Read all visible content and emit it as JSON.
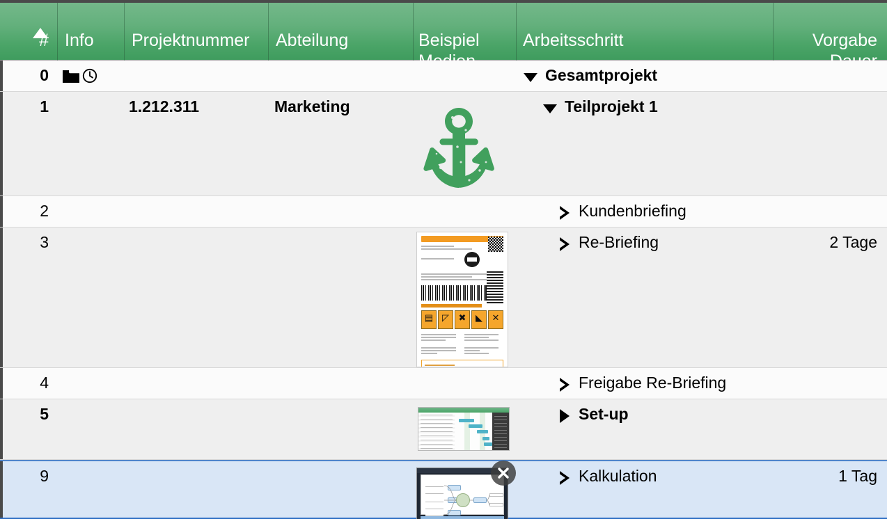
{
  "table": {
    "columns": [
      {
        "id": "num",
        "label": "#",
        "align": "right",
        "sorted": true,
        "sort_direction": "ascending"
      },
      {
        "id": "info",
        "label": "Info",
        "align": "left"
      },
      {
        "id": "proj",
        "label": "Projektnummer",
        "align": "left"
      },
      {
        "id": "abt",
        "label": "Abteilung",
        "align": "left"
      },
      {
        "id": "media",
        "label": "Beispiel\nMedien",
        "align": "left"
      },
      {
        "id": "step",
        "label": "Arbeitsschritt",
        "align": "left"
      },
      {
        "id": "dur",
        "label": "Vorgabe\nDauer",
        "align": "right"
      }
    ],
    "rows": [
      {
        "num": "0",
        "projektnummer": "",
        "abteilung": "",
        "arbeitsschritt": "Gesamtprojekt",
        "dauer": "",
        "level": 0,
        "bold": true,
        "disclosure": "expanded",
        "icons": [
          "folder-icon",
          "clock-icon"
        ],
        "media": "none",
        "stripe": "odd",
        "selected": false
      },
      {
        "num": "1",
        "projektnummer": "1.212.311",
        "abteilung": "Marketing",
        "arbeitsschritt": "Teilprojekt 1",
        "dauer": "",
        "level": 1,
        "bold": true,
        "disclosure": "expanded",
        "icons": [],
        "media": "anchor-logo",
        "stripe": "even",
        "selected": false
      },
      {
        "num": "2",
        "projektnummer": "",
        "abteilung": "",
        "arbeitsschritt": "Kundenbriefing",
        "dauer": "",
        "level": 2,
        "bold": false,
        "disclosure": "leaf",
        "icons": [],
        "media": "none",
        "stripe": "odd",
        "selected": false
      },
      {
        "num": "3",
        "projektnummer": "",
        "abteilung": "",
        "arbeitsschritt": "Re-Briefing",
        "dauer": "2 Tage",
        "level": 2,
        "bold": false,
        "disclosure": "leaf",
        "icons": [],
        "media": "shipping-label-document",
        "stripe": "even",
        "selected": false
      },
      {
        "num": "4",
        "projektnummer": "",
        "abteilung": "",
        "arbeitsschritt": "Freigabe Re-Briefing",
        "dauer": "",
        "level": 2,
        "bold": false,
        "disclosure": "leaf",
        "icons": [],
        "media": "none",
        "stripe": "odd",
        "selected": false
      },
      {
        "num": "5",
        "projektnummer": "",
        "abteilung": "",
        "arbeitsschritt": "Set-up",
        "dauer": "",
        "level": 2,
        "bold": true,
        "disclosure": "collapsed",
        "icons": [],
        "media": "gantt-chart-screenshot",
        "stripe": "even",
        "selected": false
      },
      {
        "num": "9",
        "projektnummer": "",
        "abteilung": "",
        "arbeitsschritt": "Kalkulation",
        "dauer": "1 Tag",
        "level": 2,
        "bold": false,
        "disclosure": "leaf",
        "icons": [],
        "media": "mindmap-screenshot",
        "stripe": "odd",
        "selected": true,
        "media_has_delete_badge": true
      }
    ]
  },
  "colors": {
    "header_green_top": "#74b88a",
    "header_green_bottom": "#3f9c5e",
    "header_text": "#ffffff",
    "row_odd": "#fbfbfb",
    "row_even": "#efefef",
    "row_selected_fill": "#d9e6f6",
    "row_selected_border": "#2f6fc4",
    "accent_orange": "#f39b22",
    "logo_green": "#41a05d",
    "text": "#000000"
  }
}
